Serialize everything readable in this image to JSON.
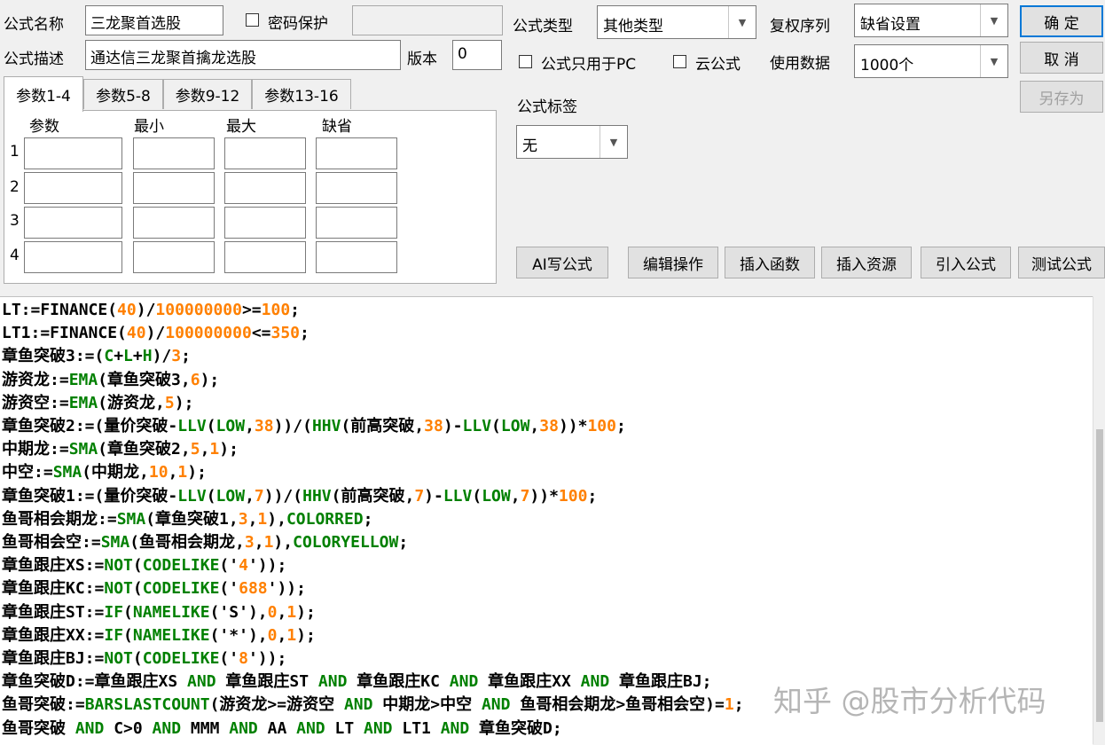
{
  "form": {
    "name_label": "公式名称",
    "name_value": "三龙聚首选股",
    "password_label": "密码保护",
    "desc_label": "公式描述",
    "desc_value": "通达信三龙聚首擒龙选股",
    "version_label": "版本",
    "version_value": "0",
    "type_label": "公式类型",
    "type_value": "其他类型",
    "rights_label": "复权序列",
    "rights_value": "缺省设置",
    "pc_only_label": "公式只用于PC",
    "cloud_label": "云公式",
    "data_label": "使用数据",
    "data_value": "1000个",
    "tag_label": "公式标签",
    "tag_value": "无"
  },
  "buttons": {
    "ok": "确  定",
    "cancel": "取  消",
    "save_as": "另存为",
    "ai_write": "AI写公式",
    "edit_ops": "编辑操作",
    "insert_func": "插入函数",
    "insert_res": "插入资源",
    "import_formula": "引入公式",
    "test_formula": "测试公式"
  },
  "param_tabs": [
    "参数1-4",
    "参数5-8",
    "参数9-12",
    "参数13-16"
  ],
  "param_headers": [
    "参数",
    "最小",
    "最大",
    "缺省"
  ],
  "param_rows": [
    "1",
    "2",
    "3",
    "4"
  ],
  "colors": {
    "number": "#ff8000",
    "function": "#008000"
  },
  "code_lines": [
    [
      [
        "LT:=FINANCE(",
        "t"
      ],
      [
        "40",
        "n"
      ],
      [
        ")/",
        "t"
      ],
      [
        "100000000",
        "n"
      ],
      [
        ">=",
        "t"
      ],
      [
        "100",
        "n"
      ],
      [
        ";",
        "t"
      ]
    ],
    [
      [
        "LT1:=FINANCE(",
        "t"
      ],
      [
        "40",
        "n"
      ],
      [
        ")/",
        "t"
      ],
      [
        "100000000",
        "n"
      ],
      [
        "<=",
        "t"
      ],
      [
        "350",
        "n"
      ],
      [
        ";",
        "t"
      ]
    ],
    [
      [
        "章鱼突破3:=(",
        "t"
      ],
      [
        "C",
        "f"
      ],
      [
        "+",
        "t"
      ],
      [
        "L",
        "f"
      ],
      [
        "+",
        "t"
      ],
      [
        "H",
        "f"
      ],
      [
        ")/",
        "t"
      ],
      [
        "3",
        "n"
      ],
      [
        ";",
        "t"
      ]
    ],
    [
      [
        "游资龙:=",
        "t"
      ],
      [
        "EMA",
        "f"
      ],
      [
        "(章鱼突破3,",
        "t"
      ],
      [
        "6",
        "n"
      ],
      [
        ");",
        "t"
      ]
    ],
    [
      [
        "游资空:=",
        "t"
      ],
      [
        "EMA",
        "f"
      ],
      [
        "(游资龙,",
        "t"
      ],
      [
        "5",
        "n"
      ],
      [
        ");",
        "t"
      ]
    ],
    [
      [
        "章鱼突破2:=(量价突破-",
        "t"
      ],
      [
        "LLV",
        "f"
      ],
      [
        "(",
        "t"
      ],
      [
        "LOW",
        "f"
      ],
      [
        ",",
        "t"
      ],
      [
        "38",
        "n"
      ],
      [
        "))/(",
        "t"
      ],
      [
        "HHV",
        "f"
      ],
      [
        "(前高突破,",
        "t"
      ],
      [
        "38",
        "n"
      ],
      [
        ")-",
        "t"
      ],
      [
        "LLV",
        "f"
      ],
      [
        "(",
        "t"
      ],
      [
        "LOW",
        "f"
      ],
      [
        ",",
        "t"
      ],
      [
        "38",
        "n"
      ],
      [
        "))*",
        "t"
      ],
      [
        "100",
        "n"
      ],
      [
        ";",
        "t"
      ]
    ],
    [
      [
        "中期龙:=",
        "t"
      ],
      [
        "SMA",
        "f"
      ],
      [
        "(章鱼突破2,",
        "t"
      ],
      [
        "5",
        "n"
      ],
      [
        ",",
        "t"
      ],
      [
        "1",
        "n"
      ],
      [
        ");",
        "t"
      ]
    ],
    [
      [
        "中空:=",
        "t"
      ],
      [
        "SMA",
        "f"
      ],
      [
        "(中期龙,",
        "t"
      ],
      [
        "10",
        "n"
      ],
      [
        ",",
        "t"
      ],
      [
        "1",
        "n"
      ],
      [
        ");",
        "t"
      ]
    ],
    [
      [
        "章鱼突破1:=(量价突破-",
        "t"
      ],
      [
        "LLV",
        "f"
      ],
      [
        "(",
        "t"
      ],
      [
        "LOW",
        "f"
      ],
      [
        ",",
        "t"
      ],
      [
        "7",
        "n"
      ],
      [
        "))/(",
        "t"
      ],
      [
        "HHV",
        "f"
      ],
      [
        "(前高突破,",
        "t"
      ],
      [
        "7",
        "n"
      ],
      [
        ")-",
        "t"
      ],
      [
        "LLV",
        "f"
      ],
      [
        "(",
        "t"
      ],
      [
        "LOW",
        "f"
      ],
      [
        ",",
        "t"
      ],
      [
        "7",
        "n"
      ],
      [
        "))*",
        "t"
      ],
      [
        "100",
        "n"
      ],
      [
        ";",
        "t"
      ]
    ],
    [
      [
        "鱼哥相会期龙:=",
        "t"
      ],
      [
        "SMA",
        "f"
      ],
      [
        "(章鱼突破1,",
        "t"
      ],
      [
        "3",
        "n"
      ],
      [
        ",",
        "t"
      ],
      [
        "1",
        "n"
      ],
      [
        "),",
        "t"
      ],
      [
        "COLORRED",
        "f"
      ],
      [
        ";",
        "t"
      ]
    ],
    [
      [
        "鱼哥相会空:=",
        "t"
      ],
      [
        "SMA",
        "f"
      ],
      [
        "(鱼哥相会期龙,",
        "t"
      ],
      [
        "3",
        "n"
      ],
      [
        ",",
        "t"
      ],
      [
        "1",
        "n"
      ],
      [
        "),",
        "t"
      ],
      [
        "COLORYELLOW",
        "f"
      ],
      [
        ";",
        "t"
      ]
    ],
    [
      [
        "章鱼跟庄XS:=",
        "t"
      ],
      [
        "NOT",
        "f"
      ],
      [
        "(",
        "t"
      ],
      [
        "CODELIKE",
        "f"
      ],
      [
        "('",
        "t"
      ],
      [
        "4",
        "n"
      ],
      [
        "'));",
        "t"
      ]
    ],
    [
      [
        "章鱼跟庄KC:=",
        "t"
      ],
      [
        "NOT",
        "f"
      ],
      [
        "(",
        "t"
      ],
      [
        "CODELIKE",
        "f"
      ],
      [
        "('",
        "t"
      ],
      [
        "688",
        "n"
      ],
      [
        "'));",
        "t"
      ]
    ],
    [
      [
        "章鱼跟庄ST:=",
        "t"
      ],
      [
        "IF",
        "f"
      ],
      [
        "(",
        "t"
      ],
      [
        "NAMELIKE",
        "f"
      ],
      [
        "('S'),",
        "t"
      ],
      [
        "0",
        "n"
      ],
      [
        ",",
        "t"
      ],
      [
        "1",
        "n"
      ],
      [
        ");",
        "t"
      ]
    ],
    [
      [
        "章鱼跟庄XX:=",
        "t"
      ],
      [
        "IF",
        "f"
      ],
      [
        "(",
        "t"
      ],
      [
        "NAMELIKE",
        "f"
      ],
      [
        "('*'),",
        "t"
      ],
      [
        "0",
        "n"
      ],
      [
        ",",
        "t"
      ],
      [
        "1",
        "n"
      ],
      [
        ");",
        "t"
      ]
    ],
    [
      [
        "章鱼跟庄BJ:=",
        "t"
      ],
      [
        "NOT",
        "f"
      ],
      [
        "(",
        "t"
      ],
      [
        "CODELIKE",
        "f"
      ],
      [
        "('",
        "t"
      ],
      [
        "8",
        "n"
      ],
      [
        "'));",
        "t"
      ]
    ],
    [
      [
        "章鱼突破D:=章鱼跟庄XS ",
        "t"
      ],
      [
        "AND",
        "f"
      ],
      [
        " 章鱼跟庄ST ",
        "t"
      ],
      [
        "AND",
        "f"
      ],
      [
        " 章鱼跟庄KC ",
        "t"
      ],
      [
        "AND",
        "f"
      ],
      [
        " 章鱼跟庄XX ",
        "t"
      ],
      [
        "AND",
        "f"
      ],
      [
        " 章鱼跟庄BJ;",
        "t"
      ]
    ],
    [
      [
        "鱼哥突破:=",
        "t"
      ],
      [
        "BARSLASTCOUNT",
        "f"
      ],
      [
        "(游资龙>=游资空 ",
        "t"
      ],
      [
        "AND",
        "f"
      ],
      [
        " 中期龙>中空 ",
        "t"
      ],
      [
        "AND",
        "f"
      ],
      [
        " 鱼哥相会期龙>鱼哥相会空)=",
        "t"
      ],
      [
        "1",
        "n"
      ],
      [
        ";",
        "t"
      ]
    ],
    [
      [
        "鱼哥突破 ",
        "t"
      ],
      [
        "AND",
        "f"
      ],
      [
        " C>0 ",
        "t"
      ],
      [
        "AND",
        "f"
      ],
      [
        " MMM ",
        "t"
      ],
      [
        "AND",
        "f"
      ],
      [
        " AA ",
        "t"
      ],
      [
        "AND",
        "f"
      ],
      [
        " LT ",
        "t"
      ],
      [
        "AND",
        "f"
      ],
      [
        " LT1 ",
        "t"
      ],
      [
        "AND",
        "f"
      ],
      [
        " 章鱼突破D;",
        "t"
      ]
    ]
  ],
  "watermark": "知乎 @股市分析代码"
}
